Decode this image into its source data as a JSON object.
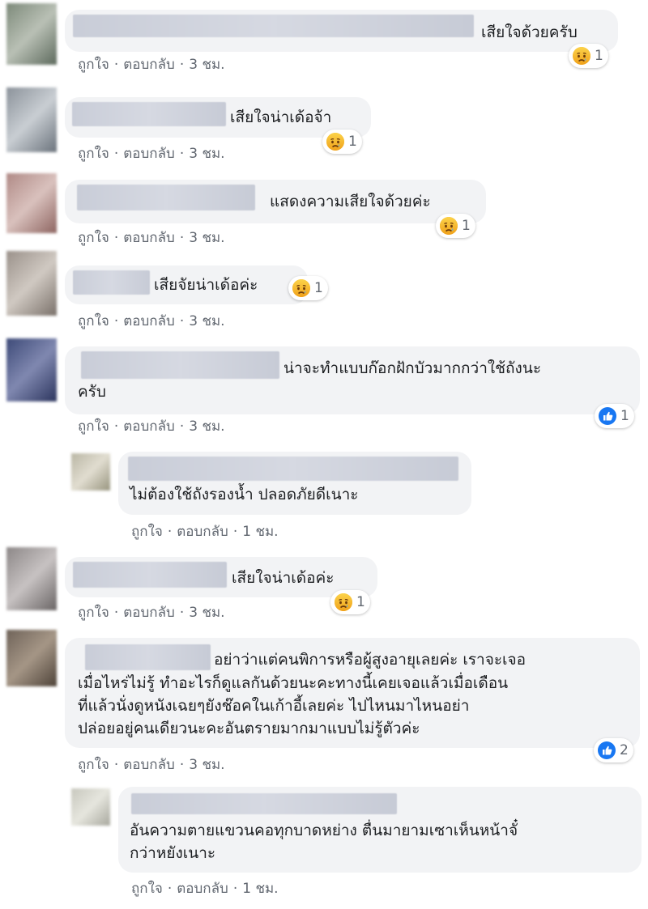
{
  "actions": {
    "like": "ถูกใจ",
    "reply": "ตอบกลับ",
    "dot": "·"
  },
  "comments": [
    {
      "text": "เสียใจด้วยครับ",
      "time": "3 ชม.",
      "reaction": "sad-icon",
      "count": "1"
    },
    {
      "text": "เสียใจน่าเด้อจ้า",
      "time": "3 ชม.",
      "reaction": "sad-icon",
      "count": "1"
    },
    {
      "text": "แสดงความเสียใจด้วยค่ะ",
      "time": "3 ชม.",
      "reaction": "sad-icon",
      "count": "1"
    },
    {
      "text": "เสียจัยน่าเด้อค่ะ",
      "time": "3 ชม.",
      "reaction": "sad-icon",
      "count": "1"
    },
    {
      "text_line1": "น่าจะทำแบบก๊อกฝักบัวมากกว่าใช้ถังนะ",
      "text_line2": "ครับ",
      "time": "3 ชม.",
      "reaction": "like-icon",
      "count": "1"
    },
    {
      "text": "ไม่ต้องใช้ถังรองน้ำ ปลอดภัยดีเนาะ",
      "time": "1 ชม."
    },
    {
      "text": "เสียใจน่าเด้อค่ะ",
      "time": "3 ชม.",
      "reaction": "sad-icon",
      "count": "1"
    },
    {
      "line1": "อย่าว่าแต่คนพิการหรือผู้สูงอายุเลยค่ะ เราจะเจอ",
      "line2": "เมื่อไหร่ไม่รู้ ทำอะไรก็ดูแลกันด้วยนะคะทางนี้เคยเจอแล้วเมื่อเดือน",
      "line3": "ที่แล้วนั่งดูหนังเฉยๆยังช๊อคในเก้าอี้เลยค่ะ ไปไหนมาไหนอย่า",
      "line4": "ปล่อยอยู่คนเดียวนะคะอันตรายมากมาแบบไม่รู้ตัวค่ะ",
      "time": "3 ชม.",
      "reaction": "like-icon",
      "count": "2"
    },
    {
      "line1": "อันความตายแขวนคอทุกบาดหย่าง ตื่นมายามเซาเห็นหน้าจั๋",
      "line2": "กว่าหยังเนาะ",
      "time": "1 ชม."
    }
  ],
  "colors": {
    "bubble": "#f2f3f5",
    "meta": "#616770",
    "like_blue": "#1877f2",
    "sad_yellow": "#f7b125"
  }
}
